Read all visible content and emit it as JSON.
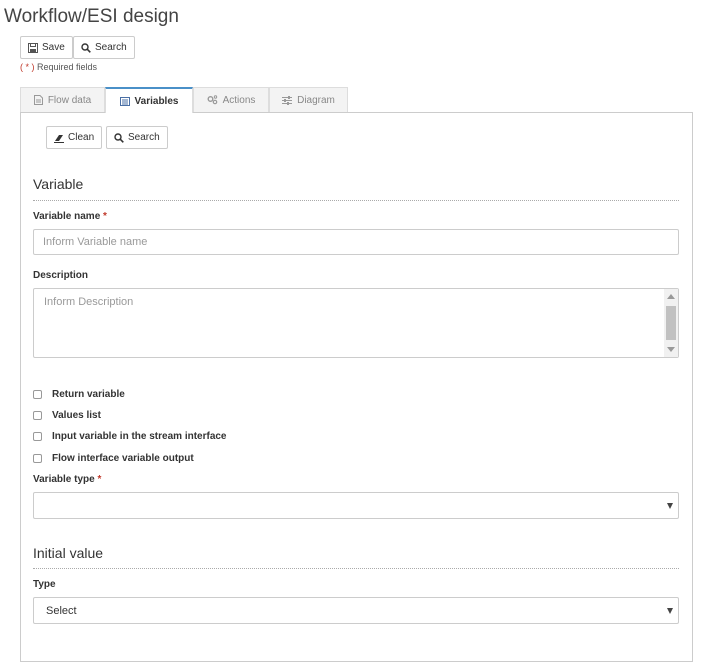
{
  "page": {
    "title": "Workflow/ESI design"
  },
  "toolbar": {
    "save_label": "Save",
    "search_label": "Search"
  },
  "required_note": {
    "star": "( * )",
    "text": "Required fields"
  },
  "tabs": [
    {
      "label": "Flow data",
      "icon": "document-icon",
      "active": false
    },
    {
      "label": "Variables",
      "icon": "list-icon",
      "active": true
    },
    {
      "label": "Actions",
      "icon": "gears-icon",
      "active": false
    },
    {
      "label": "Diagram",
      "icon": "sliders-icon",
      "active": false
    }
  ],
  "panel_toolbar": {
    "clean_label": "Clean",
    "search_label": "Search"
  },
  "variable_section": {
    "title": "Variable",
    "name_label": "Variable name",
    "name_placeholder": "Inform Variable name",
    "required_star": "*",
    "description_label": "Description",
    "description_placeholder": "Inform Description",
    "checkboxes": [
      {
        "label": "Return variable",
        "checked": false
      },
      {
        "label": "Values list",
        "checked": false
      },
      {
        "label": "Input variable in the stream interface",
        "checked": false
      },
      {
        "label": "Flow interface variable output",
        "checked": false
      }
    ],
    "type_label": "Variable type",
    "type_value": ""
  },
  "initial_value_section": {
    "title": "Initial value",
    "type_label": "Type",
    "type_value": "Select"
  },
  "colors": {
    "required": "#c0392b",
    "active_tab_accent": "#4a90c8",
    "border": "#cccccc"
  }
}
